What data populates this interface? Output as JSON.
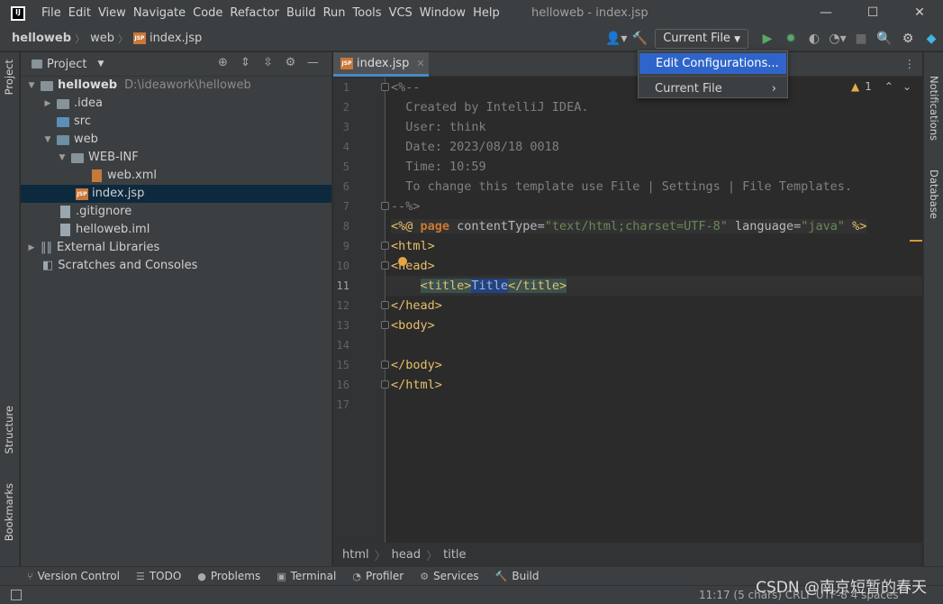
{
  "app": {
    "window_title": "helloweb - index.jsp",
    "menu": [
      "File",
      "Edit",
      "View",
      "Navigate",
      "Code",
      "Refactor",
      "Build",
      "Run",
      "Tools",
      "VCS",
      "Window",
      "Help"
    ]
  },
  "navbar": {
    "crumbs": [
      "helloweb",
      "web",
      "index.jsp"
    ],
    "run_config": "Current File"
  },
  "run_popup": {
    "items": [
      "Edit Configurations...",
      "Current File"
    ]
  },
  "side_tabs": {
    "left_top": "Project",
    "left_structure": "Structure",
    "left_bookmarks": "Bookmarks",
    "right_notifications": "Notifications",
    "right_database": "Database"
  },
  "project": {
    "header": "Project",
    "tree": [
      {
        "label": "helloweb",
        "path": "D:\\ideawork\\helloweb"
      },
      {
        "label": ".idea"
      },
      {
        "label": "src"
      },
      {
        "label": "web"
      },
      {
        "label": "WEB-INF"
      },
      {
        "label": "web.xml"
      },
      {
        "label": "index.jsp"
      },
      {
        "label": ".gitignore"
      },
      {
        "label": "helloweb.iml"
      },
      {
        "label": "External Libraries"
      },
      {
        "label": "Scratches and Consoles"
      }
    ]
  },
  "editor": {
    "tab": "index.jsp",
    "warnings": "1",
    "line_numbers": [
      "1",
      "2",
      "3",
      "4",
      "5",
      "6",
      "7",
      "8",
      "9",
      "10",
      "11",
      "12",
      "13",
      "14",
      "15",
      "16",
      "17"
    ],
    "lines": {
      "l1": "<%--",
      "l2": "  Created by IntelliJ IDEA.",
      "l3": "  User: think",
      "l4": "  Date: 2023/08/18 0018",
      "l5": "  Time: 10:59",
      "l6": "  To change this template use File | Settings | File Templates.",
      "l7": "--%>",
      "l8a": "<%@ ",
      "l8b": "page",
      "l8c": " contentType",
      "l8d": "=",
      "l8e": "\"text/html;charset=UTF-8\"",
      "l8f": " language",
      "l8g": "=",
      "l8h": "\"java\"",
      "l8i": " %>",
      "l9": "<html>",
      "l10": "<head>",
      "l11a": "<title>",
      "l11b": "Title",
      "l11c": "</title>",
      "l12": "</head>",
      "l13": "<body>",
      "l15": "</body>",
      "l16": "</html>"
    },
    "breadcrumbs": [
      "html",
      "head",
      "title"
    ]
  },
  "bottom_tools": [
    "Version Control",
    "TODO",
    "Problems",
    "Terminal",
    "Profiler",
    "Services",
    "Build"
  ],
  "status": {
    "position": "11:17 (5 chars)  CRLF  UTF-8  4 spaces"
  },
  "watermark": "CSDN @南京短暂的春天"
}
